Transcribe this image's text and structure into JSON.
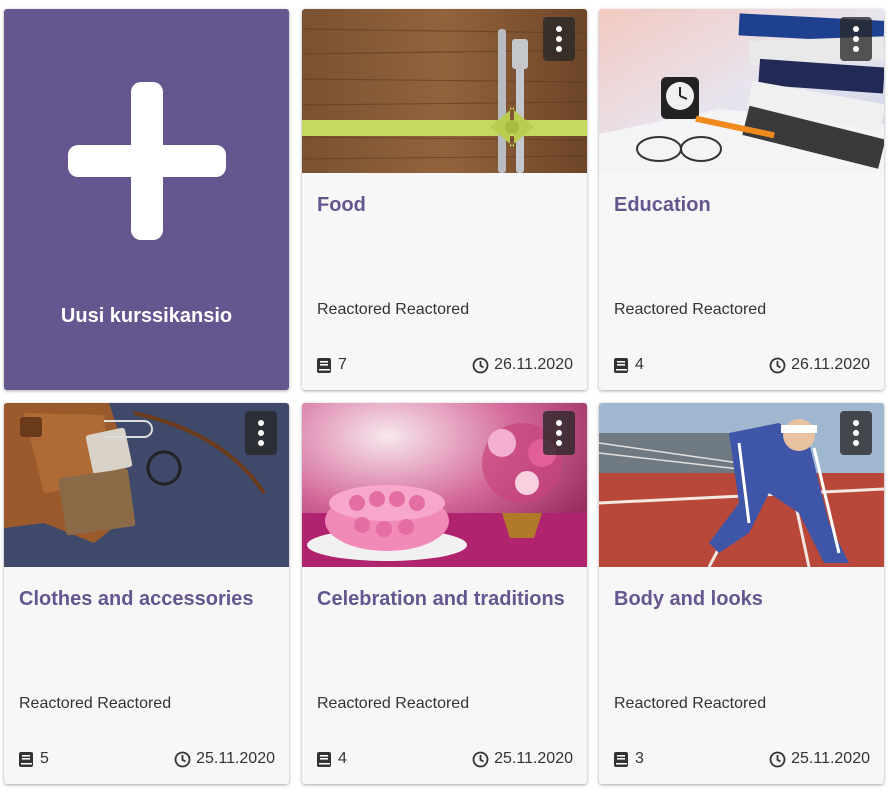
{
  "new_folder": {
    "label": "Uusi kurssikansio",
    "icon": "plus-icon"
  },
  "colors": {
    "accent": "#65568f",
    "card_bg": "#f7f7f8"
  },
  "cards": [
    {
      "title": "Food",
      "author": "Reactored Reactored",
      "count": "7",
      "date": "26.11.2020",
      "image": "cutlery-on-wood"
    },
    {
      "title": "Education",
      "author": "Reactored Reactored",
      "count": "4",
      "date": "26.11.2020",
      "image": "books-and-clock"
    },
    {
      "title": "Clothes and accessories",
      "author": "Reactored Reactored",
      "count": "5",
      "date": "25.11.2020",
      "image": "leather-bag"
    },
    {
      "title": "Celebration and traditions",
      "author": "Reactored Reactored",
      "count": "4",
      "date": "25.11.2020",
      "image": "pink-cake"
    },
    {
      "title": "Body and looks",
      "author": "Reactored Reactored",
      "count": "3",
      "date": "25.11.2020",
      "image": "runner-on-track"
    }
  ]
}
